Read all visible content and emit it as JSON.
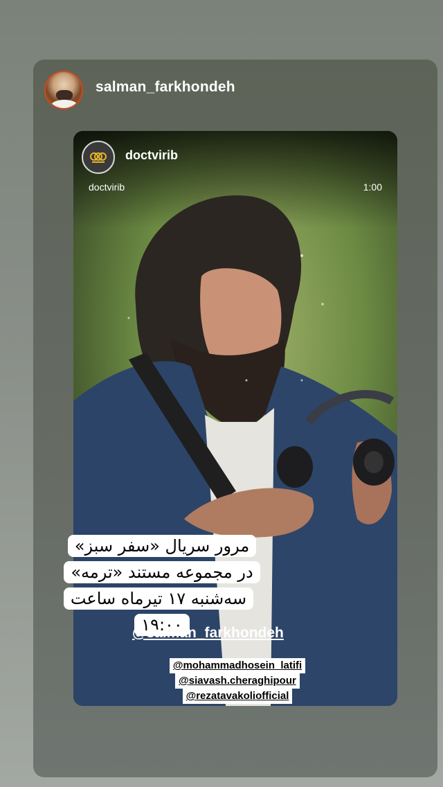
{
  "story_header": {
    "username": "salman_farkhondeh"
  },
  "reshared_post": {
    "username": "doctvirib",
    "video_label": "doctvirib",
    "duration": "1:00"
  },
  "caption_lines": [
    "مرور سریال «سفر سبز»",
    "در مجموعه مستند «ترمه»",
    "سه‌شنبه ۱۷ تیرماه ساعت ۱۹:۰۰"
  ],
  "mentions": {
    "main": "salman_farkhondeh",
    "others": [
      "mohammadhosein_latifi",
      "siavash.cheraghipour",
      "rezatavakoliofficial"
    ]
  },
  "colors": {
    "page_bg": "#7b827a",
    "card_bg": "#5d6357",
    "avatar_ring": "#c74b1f",
    "sticker_bg": "#ffffff"
  },
  "icons": {
    "mention_symbol": "@",
    "channel_logo": "doc-tv-logo-icon"
  }
}
